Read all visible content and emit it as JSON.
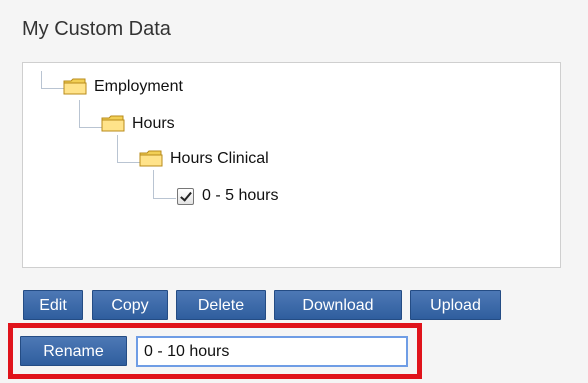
{
  "title": "My Custom Data",
  "tree": {
    "nodes": [
      {
        "label": "Employment",
        "type": "folder"
      },
      {
        "label": "Hours",
        "type": "folder"
      },
      {
        "label": "Hours Clinical",
        "type": "folder"
      },
      {
        "label": "0 - 5 hours",
        "type": "checkbox",
        "checked": true
      }
    ]
  },
  "buttons": {
    "edit": "Edit",
    "copy": "Copy",
    "delete": "Delete",
    "download": "Download",
    "upload": "Upload",
    "rename": "Rename"
  },
  "rename_input": {
    "value": "0 - 10 hours"
  },
  "colors": {
    "button": "#2f5e9e",
    "highlight": "#e0131b",
    "folder": "#f2cf55"
  }
}
